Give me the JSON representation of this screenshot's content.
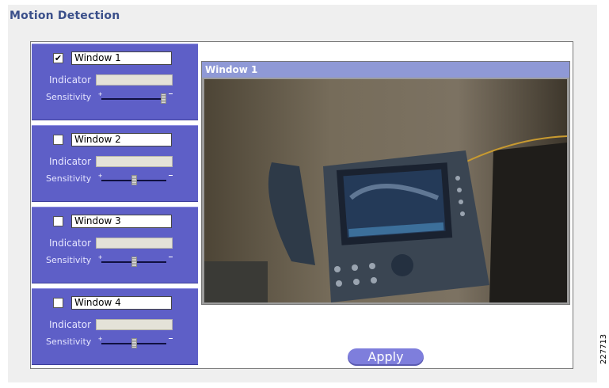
{
  "page": {
    "title": "Motion Detection",
    "figure_id": "227713"
  },
  "windows": [
    {
      "name": "Window 1",
      "checked": true,
      "indicator_label": "Indicator",
      "sensitivity_label": "Sensitivity",
      "sensitivity": 1.0
    },
    {
      "name": "Window 2",
      "checked": false,
      "indicator_label": "Indicator",
      "sensitivity_label": "Sensitivity",
      "sensitivity": 0.5
    },
    {
      "name": "Window 3",
      "checked": false,
      "indicator_label": "Indicator",
      "sensitivity_label": "Sensitivity",
      "sensitivity": 0.5
    },
    {
      "name": "Window 4",
      "checked": false,
      "indicator_label": "Indicator",
      "sensitivity_label": "Sensitivity",
      "sensitivity": 0.5
    }
  ],
  "video": {
    "title": "Window 1"
  },
  "apply_label": "Apply",
  "colors": {
    "sidebar": "#5e5fc7",
    "title": "#3a4f8a",
    "video_titlebar": "#8f99d6",
    "apply": "#7e7edc"
  },
  "icons": {
    "checkbox_checked": "check-mark",
    "slider_plus": "plus-icon",
    "slider_minus": "minus-icon"
  }
}
